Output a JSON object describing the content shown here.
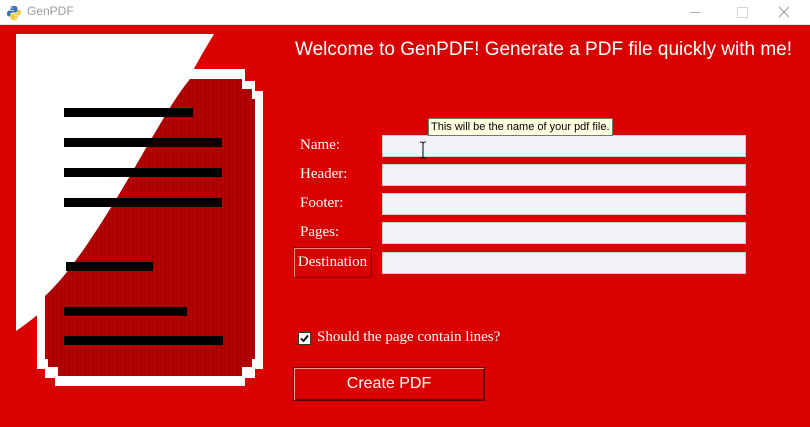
{
  "window": {
    "title": "GenPDF",
    "accent_color": "#d90000",
    "app_icon": "python-icon"
  },
  "heading": "Welcome to GenPDF! Generate a PDF file quickly with me!",
  "form": {
    "name_label": "Name:",
    "name_value": "",
    "header_label": "Header:",
    "header_value": "",
    "footer_label": "Footer:",
    "footer_value": "",
    "pages_label": "Pages:",
    "pages_value": "",
    "destination_button": "Destination",
    "destination_value": ""
  },
  "tooltip": "This will be the name of your pdf file.",
  "lines_option": {
    "label": "Should the page contain lines?",
    "checked": true
  },
  "create_button": "Create PDF"
}
